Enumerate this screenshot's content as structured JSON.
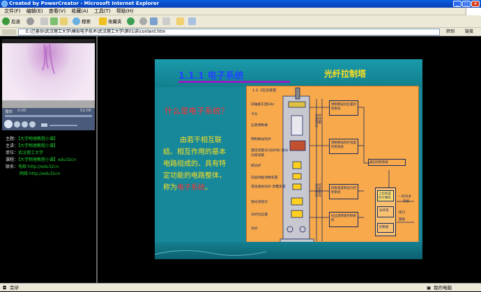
{
  "window": {
    "title": "Created by PowerCreator - Microsoft Internet Explorer",
    "min_icon": "minimize-icon",
    "max_icon": "maximize-icon",
    "close_icon": "close-icon"
  },
  "menu": [
    "文件(F)",
    "编辑(E)",
    "查看(V)",
    "收藏(A)",
    "工具(T)",
    "帮助(H)"
  ],
  "toolbar": {
    "back": "后退",
    "search": "搜索",
    "favorites": "收藏夹"
  },
  "address": {
    "path": "E:\\已备份\\武汉理工大学\\模拟电子技术\\武汉理工大学\\第01讲\\content.htm",
    "go": "转到",
    "links": "链接"
  },
  "player": {
    "status_label": "播放",
    "time_left": "0:00",
    "time_right": "52:06"
  },
  "course_info": [
    {
      "key": "主题：",
      "value": "【大学物理教程小课】"
    },
    {
      "key": "主讲：",
      "value": "【大学物理教程小课】"
    },
    {
      "key": "单位：",
      "value": "武汉理工大学"
    },
    {
      "key": "课程：",
      "value": "【大学物理教程小课】edu32cn"
    },
    {
      "key": "联系：",
      "value": "电邮 http://edu32cn"
    },
    {
      "key": "",
      "value": "网络 http://edu32cn"
    }
  ],
  "slide": {
    "title": "1.1.1 电子系统",
    "diagram_title": "光纤拉制塔",
    "question": "什么是电子系统？",
    "body_lines": [
      "由若干相互联",
      "结、相互作用的基本",
      "电路组成的、具有特",
      "定功能的电路整体，"
    ],
    "body_last_prefix": "称为",
    "body_last_highlight": "电子系统",
    "body_last_suffix": "。"
  },
  "diagram": {
    "caption": "1.2. 2拉丝装置",
    "left_labels": [
      "同轴基于图1do",
      "卡头",
      "石英预制棒",
      "预制棒加热炉",
      "直径测量仪(光纤线) 激光功率测量",
      "碳光纤",
      "双层树脂涂敷装置",
      "溶浴透射光纤 涂覆测量",
      "激光测径仪",
      "光纤拉丝盘",
      "光纤"
    ],
    "mid_boxes": [
      "预制棒运动位置控制系统",
      "预制棒加热炉温度控制系统",
      "树脂温度和压力控制系统",
      "拉丝盘转速控制系统"
    ],
    "vertical_labels": [
      "光纤直径测量仪",
      "光纤温度测量信号"
    ],
    "right_boxes": [
      "通信控制系统",
      "上位机监控计算机",
      "光纤塔",
      "控制柜"
    ],
    "right_note_1": "一机对多",
    "right_note_2": "系统",
    "right_note_3": "接口",
    "right_note_4": "键盘"
  },
  "status": {
    "left": "完毕",
    "zone": "我的电脑"
  },
  "colors": {
    "title_blue": "#2244ff",
    "question_red": "#ff3030",
    "text_yellow": "#ffe020",
    "slide_bg": "#16889a",
    "diagram_bg": "#f7a94b",
    "info_green": "#20d030"
  }
}
